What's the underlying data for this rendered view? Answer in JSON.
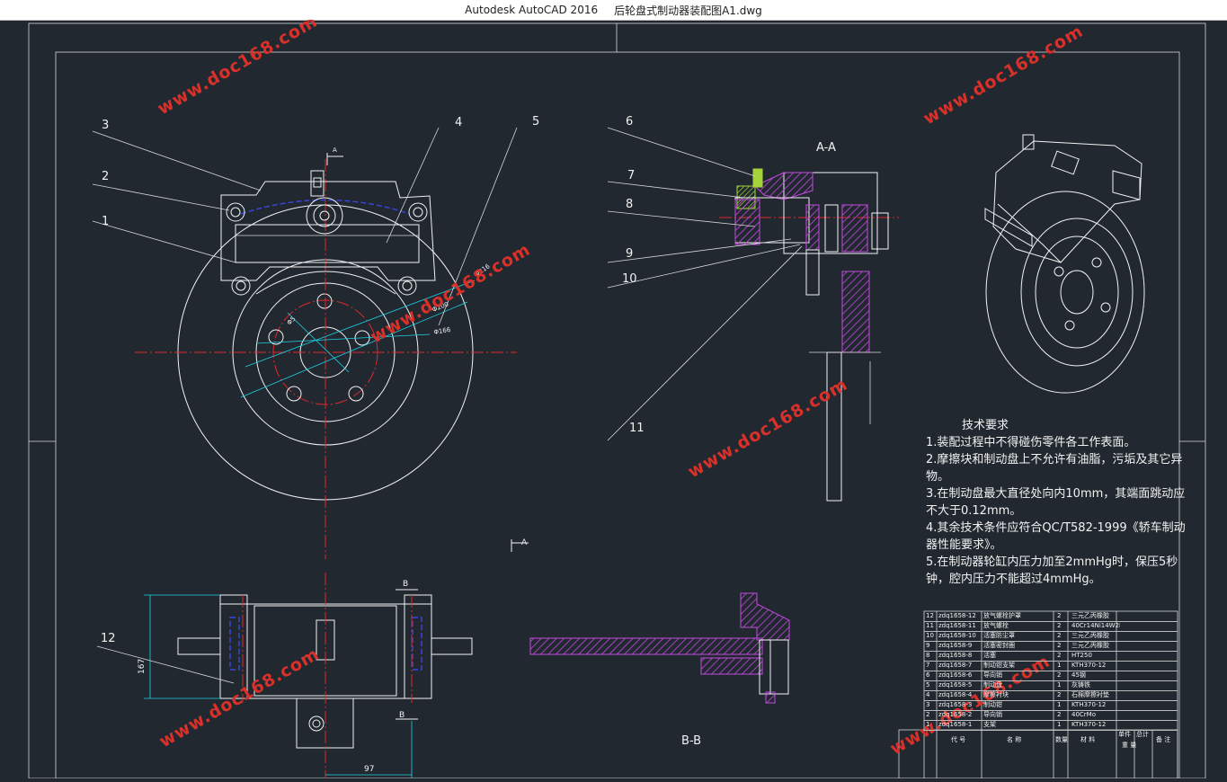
{
  "window": {
    "app": "Autodesk AutoCAD 2016",
    "file": "后轮盘式制动器装配图A1.dwg"
  },
  "watermark": "www.doc168.com",
  "labels": {
    "section_aa": "A-A",
    "section_bb": "B-B",
    "cut_a": "A",
    "cut_b": "B",
    "dim_phi216": "Φ216",
    "dim_phi200": "Φ200",
    "dim_phi166": "Φ166",
    "dim_phi5": "Φ5",
    "dim_167": "167",
    "dim_97": "97",
    "balloons": [
      "1",
      "2",
      "3",
      "4",
      "5",
      "6",
      "7",
      "8",
      "9",
      "10",
      "11",
      "12"
    ]
  },
  "tech_requirements": {
    "title": "技术要求",
    "items": [
      "1.装配过程中不得碰伤零件各工作表面。",
      "2.摩擦块和制动盘上不允许有油脂，污垢及其它异物。",
      "3.在制动盘最大直径处向内10mm，其端面跳动应不大于0.12mm。",
      "4.其余技术条件应符合QC/T582-1999《轿车制动器性能要求》。",
      "5.在制动器轮缸内压力加至2mmHg时，保压5秒钟，腔内压力不能超过4mmHg。"
    ]
  },
  "bom": {
    "rows": [
      {
        "no": "12",
        "code": "zdq1658-12",
        "name": "放气螺栓护罩",
        "qty": "2",
        "material": "三元乙丙橡胶"
      },
      {
        "no": "11",
        "code": "zdq1658-11",
        "name": "放气螺栓",
        "qty": "2",
        "material": "40Cr14Ni14W2Mo"
      },
      {
        "no": "10",
        "code": "zdq1658-10",
        "name": "活塞防尘罩",
        "qty": "2",
        "material": "三元乙丙橡胶"
      },
      {
        "no": "9",
        "code": "zdq1658-9",
        "name": "活塞密封圈",
        "qty": "2",
        "material": "三元乙丙橡胶"
      },
      {
        "no": "8",
        "code": "zdq1658-8",
        "name": "活塞",
        "qty": "2",
        "material": "HT250"
      },
      {
        "no": "7",
        "code": "zdq1658-7",
        "name": "制动钳支架",
        "qty": "1",
        "material": "KTH370-12"
      },
      {
        "no": "6",
        "code": "zdq1658-6",
        "name": "导向销",
        "qty": "2",
        "material": "45钢"
      },
      {
        "no": "5",
        "code": "zdq1658-5",
        "name": "制动盘",
        "qty": "1",
        "material": "灰铸铁"
      },
      {
        "no": "4",
        "code": "zdq1658-4",
        "name": "摩擦衬块",
        "qty": "2",
        "material": "石棉摩擦衬垫"
      },
      {
        "no": "3",
        "code": "zdq1658-3",
        "name": "制动钳",
        "qty": "1",
        "material": "KTH370-12"
      },
      {
        "no": "2",
        "code": "zdq1658-2",
        "name": "导向销",
        "qty": "2",
        "material": "40CrMo"
      },
      {
        "no": "1",
        "code": "zdq1658-1",
        "name": "支架",
        "qty": "1",
        "material": "KTH370-12"
      }
    ],
    "header": {
      "code": "代 号",
      "name": "名 称",
      "qty": "数量",
      "material": "材 料",
      "single": "单件",
      "total": "总计",
      "weight": "重 量",
      "note": "备 注"
    }
  },
  "colors": {
    "background": "#212830",
    "lines": "#f2f2f2",
    "center": "#e0282d",
    "hidden": "#3a46e0",
    "dimension": "#1fd2e6",
    "hatch": "#c44ae0",
    "watermark": "#d9302a"
  }
}
